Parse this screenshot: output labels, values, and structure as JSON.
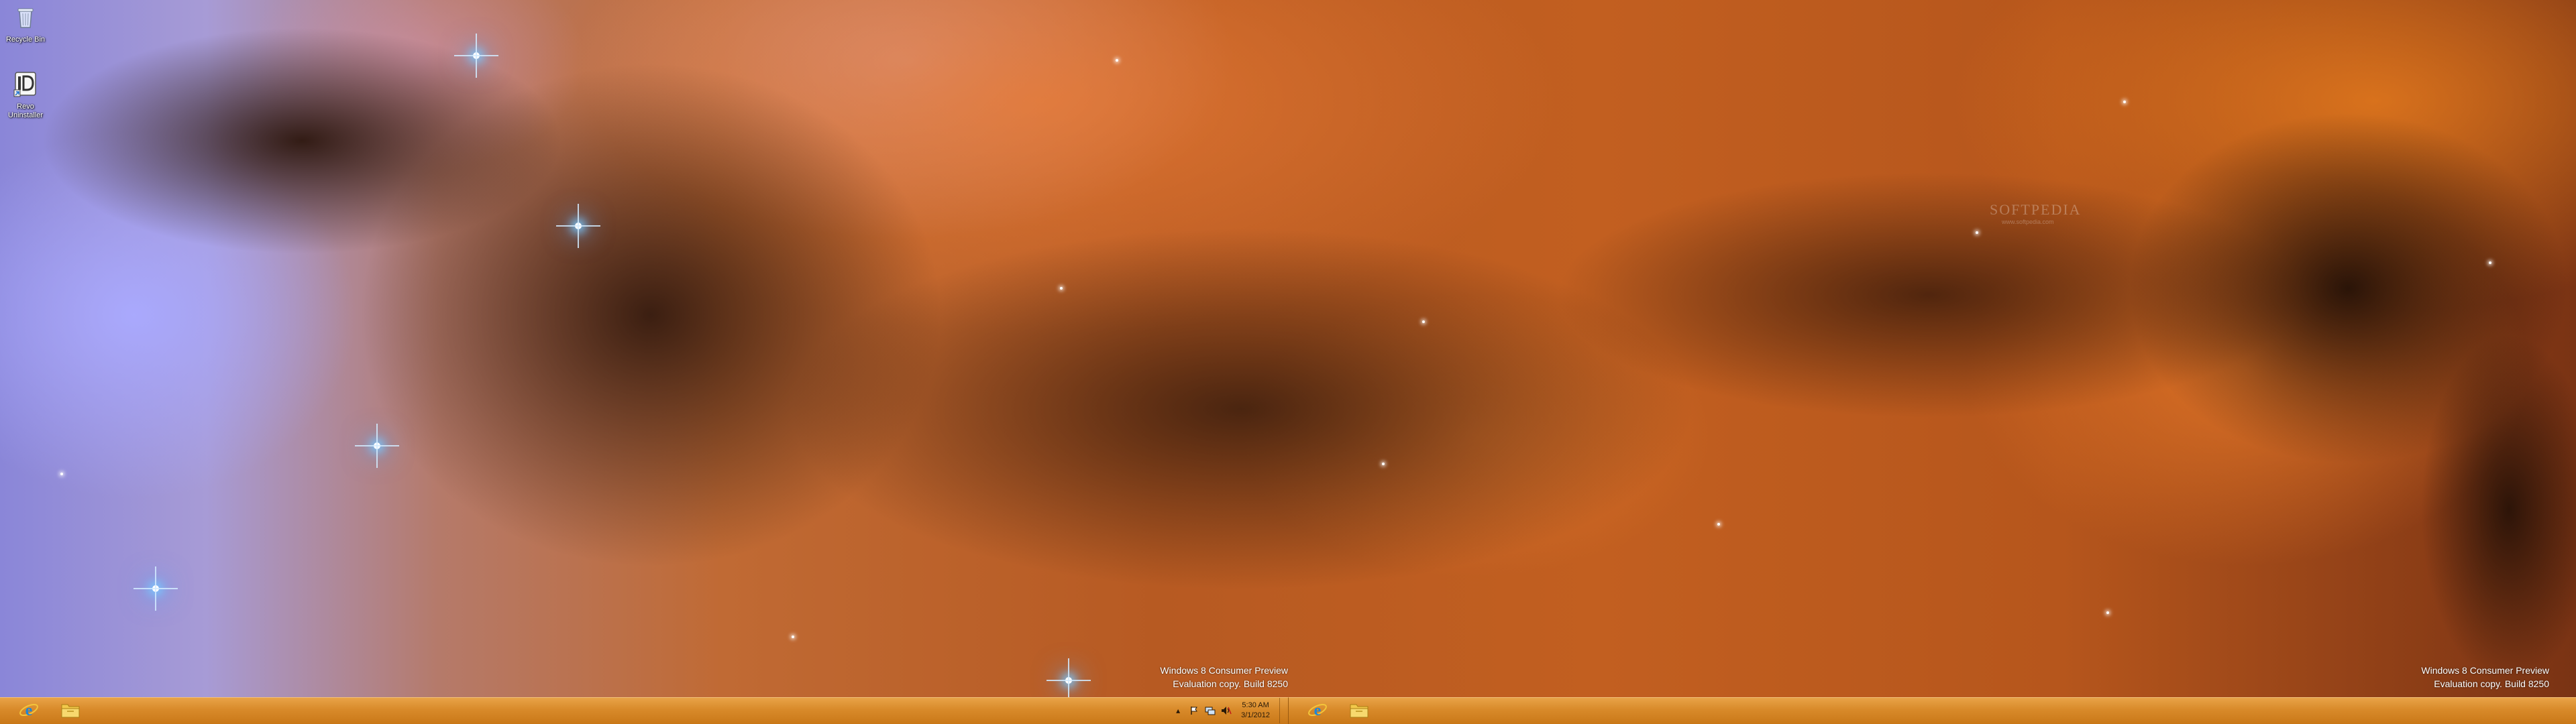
{
  "desktop": {
    "icons": [
      {
        "label": "Recycle Bin",
        "icon": "recycle-bin-icon"
      },
      {
        "label": "Revo Uninstaller",
        "icon": "revo-uninstaller-icon"
      }
    ],
    "watermark": {
      "brand": "SOFTPEDIA",
      "url": "www.softpedia.com"
    },
    "eval_left": {
      "line1": "Windows 8 Consumer Preview",
      "line2": "Evaluation copy. Build 8250"
    },
    "eval_right": {
      "line1": "Windows 8 Consumer Preview",
      "line2": "Evaluation copy. Build 8250"
    }
  },
  "taskbar_left": {
    "pinned": [
      {
        "icon": "internet-explorer-icon"
      },
      {
        "icon": "file-explorer-icon"
      }
    ],
    "tray": {
      "icons": [
        "show-hidden-icons-icon",
        "action-center-flag-icon",
        "network-icon",
        "volume-icon"
      ],
      "time": "5:30 AM",
      "date": "3/1/2012"
    }
  },
  "taskbar_right": {
    "pinned": [
      {
        "icon": "internet-explorer-icon"
      },
      {
        "icon": "file-explorer-icon"
      }
    ]
  },
  "colors": {
    "taskbar": "#d88a2a",
    "ie_blue": "#1e86d8",
    "folder_yellow": "#f2c84b"
  }
}
